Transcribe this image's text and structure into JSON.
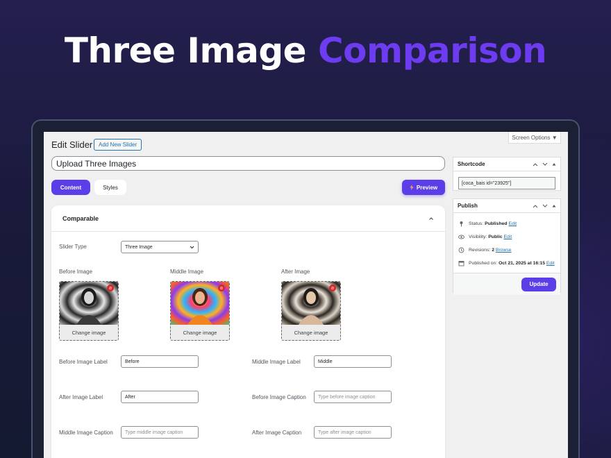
{
  "hero": {
    "title_white": "Three Image",
    "title_accent": "Comparison"
  },
  "colors": {
    "accent": "#6d3cf0",
    "button": "#5b3ee8",
    "link": "#2271b1"
  },
  "editor": {
    "screen_options": "Screen Options ▼",
    "page_title": "Edit Slider",
    "add_new_label": "Add New Slider",
    "slider_title_value": "Upload Three Images",
    "tabs": {
      "content": "Content",
      "styles": "Styles"
    },
    "preview_label": "Preview"
  },
  "panel": {
    "title": "Comparable",
    "slider_type_label": "Slider Type",
    "slider_type_value": "Three Image",
    "images": [
      {
        "label": "Before Image",
        "button": "Change image",
        "style": "grayscale"
      },
      {
        "label": "Middle Image",
        "button": "Change image",
        "style": "color"
      },
      {
        "label": "After Image",
        "button": "Change image",
        "style": "sepia"
      }
    ],
    "fields": {
      "before_label": {
        "label": "Before Image Label",
        "value": "Before"
      },
      "middle_label": {
        "label": "Middle Image Label",
        "value": "Middle"
      },
      "after_label": {
        "label": "After Image Label",
        "value": "After"
      },
      "before_caption": {
        "label": "Before Image Caption",
        "placeholder": "Type before image caption"
      },
      "middle_caption": {
        "label": "Middle Image Caption",
        "placeholder": "Type middle image caption"
      },
      "after_caption": {
        "label": "After Image Caption",
        "placeholder": "Type after image caption"
      }
    }
  },
  "sidebar": {
    "shortcode": {
      "title": "Shortcode",
      "value": "[coca_bais id=\"23925\"]"
    },
    "publish": {
      "title": "Publish",
      "status_prefix": "Status:",
      "status_value": "Published",
      "status_link": "Edit",
      "visibility_prefix": "Visibility:",
      "visibility_value": "Public",
      "visibility_link": "Edit",
      "revisions_prefix": "Revisions:",
      "revisions_value": "2",
      "revisions_link": "Browse",
      "published_prefix": "Published on:",
      "published_value": "Oct 21, 2025 at 16:15",
      "published_link": "Edit",
      "update_label": "Update"
    }
  }
}
